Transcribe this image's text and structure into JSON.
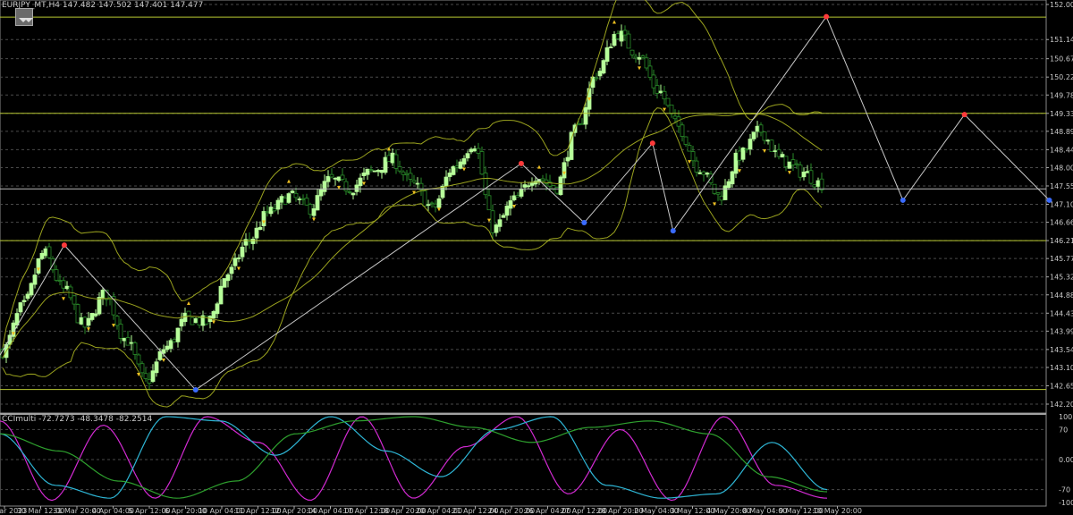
{
  "header": {
    "symbol_info": "EURJPY_MT,H4  147.482 147.502 147.401 147.477",
    "indicator_info": "CCImulti -72.7273 -48.3478 -82.2514"
  },
  "colors": {
    "background": "#000000",
    "candle_up": "#b7ff9a",
    "candle_down": "#2a8c2a",
    "bands": "#9aa21e",
    "zigzag": "#c8c8c8",
    "fractal_up": "#ff3a3a",
    "fractal_down": "#3a6bff",
    "arrow": "#f0c020",
    "level_line": "#b8c832",
    "cci_magenta": "#d22ad2",
    "cci_cyan": "#2eb6d6",
    "cci_green": "#2ea02e"
  },
  "icons": {
    "chart_toggle": "collapse-arrows-icon"
  },
  "chart_data": [
    {
      "type": "candlestick",
      "ylim": [
        142.2,
        152.0
      ],
      "y_ticks": [
        "152.000",
        "151.140",
        "150.670",
        "150.220",
        "149.780",
        "149.330",
        "148.890",
        "148.440",
        "148.000",
        "147.550",
        "147.100",
        "146.660",
        "146.210",
        "145.770",
        "145.320",
        "144.880",
        "144.430",
        "143.990",
        "143.540",
        "143.100",
        "142.650",
        "142.200"
      ],
      "x_ticks": [
        "29 Mar 2023",
        "30 Mar 12:00",
        "31 Mar 20:00",
        "4 Apr 04:00",
        "5 Apr 12:00",
        "6 Apr 20:00",
        "10 Apr 04:00",
        "11 Apr 12:00",
        "12 Apr 20:00",
        "14 Apr 04:00",
        "17 Apr 12:00",
        "18 Apr 20:00",
        "20 Apr 04:00",
        "21 Apr 12:00",
        "24 Apr 20:00",
        "26 Apr 04:00",
        "27 Apr 12:00",
        "28 Apr 20:00",
        "2 May 04:00",
        "3 May 12:00",
        "4 May 20:00",
        "8 May 04:00",
        "9 May 12:00",
        "10 May 20:00"
      ],
      "close_path": [
        143.5,
        144.6,
        145.9,
        145.0,
        144.1,
        144.9,
        143.8,
        142.75,
        143.6,
        144.3,
        144.2,
        145.4,
        146.2,
        146.9,
        147.3,
        147.0,
        147.7,
        147.5,
        147.9,
        148.2,
        147.6,
        147.0,
        148.0,
        148.6,
        146.5,
        147.2,
        147.8,
        147.5,
        148.9,
        150.3,
        151.3,
        150.8,
        149.9,
        149.0,
        148.0,
        147.3,
        148.3,
        148.9,
        148.2,
        147.9,
        147.6
      ],
      "horizontal_levels": [
        151.69,
        149.33,
        146.21,
        142.56
      ],
      "current_price": 147.477,
      "zigzag": [
        {
          "x": 0,
          "y": 143.4
        },
        {
          "x": 4.7,
          "y": 146.1
        },
        {
          "x": 14.3,
          "y": 142.55
        },
        {
          "x": 38.1,
          "y": 148.1
        },
        {
          "x": 42.7,
          "y": 146.65
        },
        {
          "x": 47.7,
          "y": 148.6
        },
        {
          "x": 49.2,
          "y": 146.45
        },
        {
          "x": 60.4,
          "y": 151.7
        },
        {
          "x": 66.0,
          "y": 147.2
        },
        {
          "x": 70.5,
          "y": 149.3
        },
        {
          "x": 76.7,
          "y": 147.2
        }
      ]
    },
    {
      "type": "line",
      "title": "CCImulti",
      "ylim": [
        -100,
        100
      ],
      "y_ticks": [
        "100",
        "70",
        "0.00",
        "-70",
        "-100"
      ],
      "series": [
        {
          "values": [
            90,
            -95,
            80,
            -90,
            100,
            40,
            -95,
            100,
            -90,
            30,
            100,
            -80,
            70,
            -95,
            100,
            -60,
            -90
          ]
        },
        {
          "values": [
            60,
            -60,
            -90,
            100,
            90,
            10,
            100,
            20,
            -40,
            70,
            100,
            -60,
            -90,
            -80,
            40,
            -70
          ]
        },
        {
          "values": [
            60,
            20,
            -50,
            -90,
            -50,
            60,
            90,
            100,
            75,
            40,
            75,
            90,
            60,
            -40,
            -75
          ]
        }
      ]
    }
  ]
}
